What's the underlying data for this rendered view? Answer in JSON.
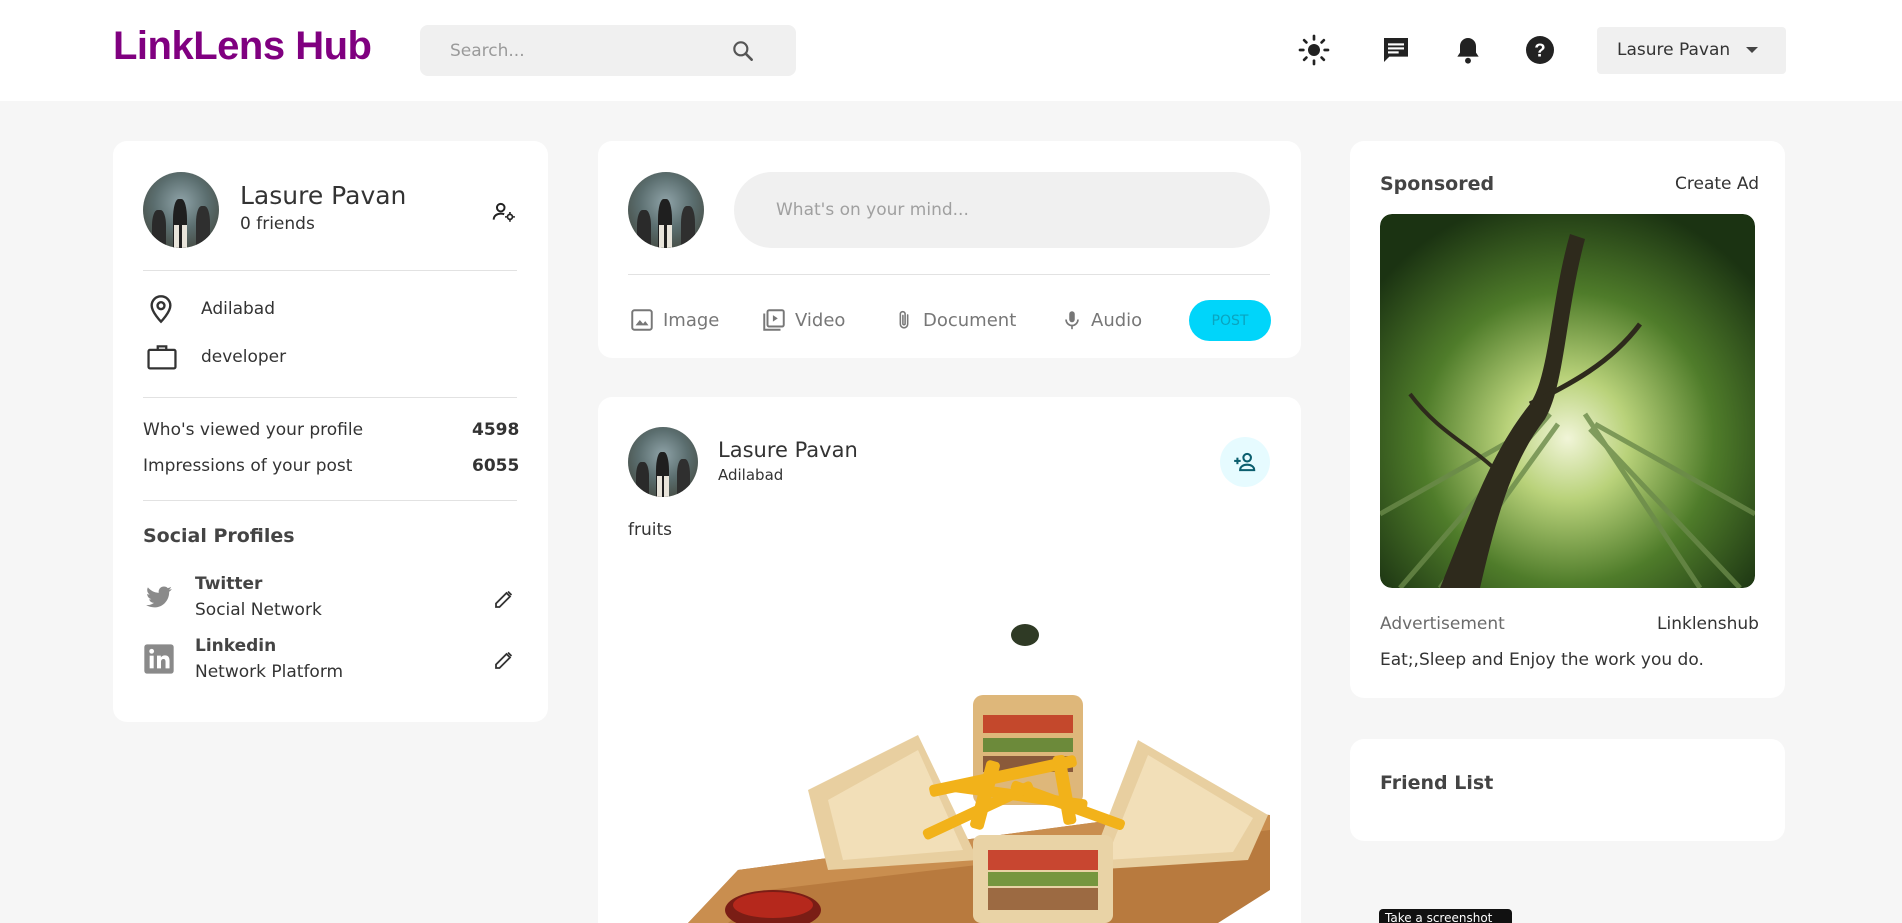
{
  "header": {
    "brand": "LinkLens Hub",
    "search_placeholder": "Search...",
    "user_name": "Lasure Pavan"
  },
  "profile_card": {
    "name": "Lasure Pavan",
    "friends": "0 friends",
    "location": "Adilabad",
    "occupation": "developer",
    "stats": [
      {
        "label": "Who's viewed your profile",
        "value": "4598"
      },
      {
        "label": "Impressions of your post",
        "value": "6055"
      }
    ],
    "social_title": "Social Profiles",
    "socials": [
      {
        "name": "Twitter",
        "subtitle": "Social Network"
      },
      {
        "name": "Linkedin",
        "subtitle": "Network Platform"
      }
    ]
  },
  "composer": {
    "placeholder": "What's on your mind...",
    "actions": [
      "Image",
      "Video",
      "Document",
      "Audio"
    ],
    "post_label": "POST"
  },
  "post": {
    "author": "Lasure Pavan",
    "location": "Adilabad",
    "caption": "fruits"
  },
  "sponsored": {
    "title": "Sponsored",
    "create_ad": "Create Ad",
    "ad_label": "Advertisement",
    "ad_source": "Linklenshub",
    "ad_text": "Eat;,Sleep and Enjoy the work you do."
  },
  "friend_list": {
    "title": "Friend List"
  },
  "tooltip": "Take a screenshot",
  "colors": {
    "brand": "#800080",
    "post_button": "#00d5fa",
    "background": "#f6f6f6"
  }
}
